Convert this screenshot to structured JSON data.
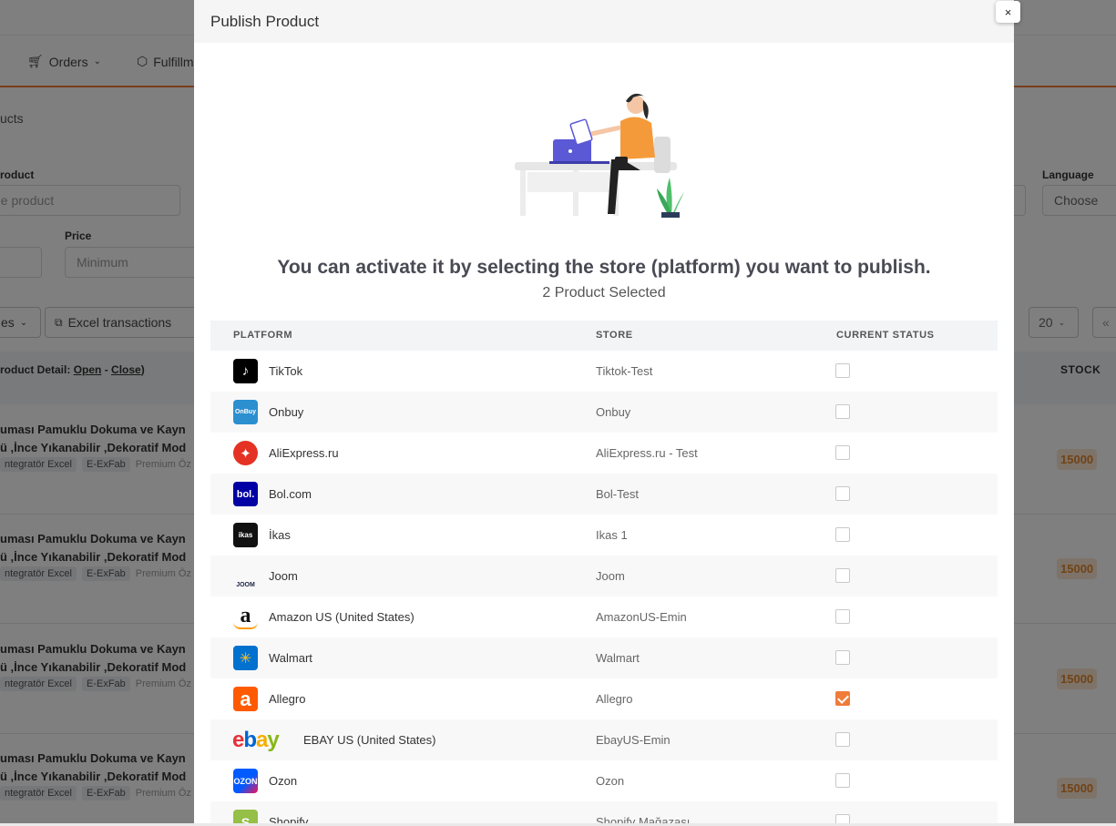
{
  "background": {
    "nav": {
      "orders": "Orders",
      "fulfillment": "Fulfillm"
    },
    "breadcrumb": "ucts",
    "filters": {
      "product_label": "roduct",
      "product_placeholder": "he product",
      "price_label": "Price",
      "price_min_placeholder": "Minimum",
      "language_label": "Language",
      "language_value": "Choose"
    },
    "toolbar": {
      "es_label": "es",
      "excel_label": "Excel transactions",
      "page_size": "20"
    },
    "table": {
      "product_detail": "roduct Detail:",
      "open": "Open",
      "close": "Close",
      "stock_header": "STOCK",
      "rows": [
        {
          "line1": "uması Pamuklu Dokuma ve Kayn",
          "line2": "ü ,İnce Yıkanabilir ,Dekoratif Mod",
          "tag1": "ntegratör Excel",
          "tag2": "E-ExFab",
          "tag3": "Premium Öz",
          "stock": "15000"
        },
        {
          "line1": "uması Pamuklu Dokuma ve Kayn",
          "line2": "ü ,İnce Yıkanabilir ,Dekoratif Mod",
          "tag1": "ntegratör Excel",
          "tag2": "E-ExFab",
          "tag3": "Premium Öz",
          "stock": "15000"
        },
        {
          "line1": "uması Pamuklu Dokuma ve Kayn",
          "line2": "ü ,İnce Yıkanabilir ,Dekoratif Mod",
          "tag1": "ntegratör Excel",
          "tag2": "E-ExFab",
          "tag3": "Premium Öz",
          "stock": "15000"
        },
        {
          "line1": "uması Pamuklu Dokuma ve Kayn",
          "line2": "ü ,İnce Yıkanabilir ,Dekoratif Mod",
          "tag1": "ntegratör Excel",
          "tag2": "E-ExFab",
          "tag3": "Premium Öz",
          "stock": "15000"
        }
      ]
    }
  },
  "modal": {
    "title": "Publish Product",
    "close_label": "×",
    "heading": "You can activate it by selecting the store (platform) you want to publish.",
    "subheading": "2 Product Selected",
    "columns": {
      "platform": "PLATFORM",
      "store": "STORE",
      "status": "CURRENT STATUS"
    },
    "rows": [
      {
        "platform": "TikTok",
        "store": "Tiktok-Test",
        "checked": false,
        "logo_text": "♪",
        "logo_color": "#000000",
        "logo_icon": "tiktok-logo-icon"
      },
      {
        "platform": "Onbuy",
        "store": "Onbuy",
        "checked": false,
        "logo_text": "OnBuy",
        "logo_color": "#2b8fd0",
        "logo_icon": "onbuy-logo-icon"
      },
      {
        "platform": "AliExpress.ru",
        "store": "AliExpress.ru - Test",
        "checked": false,
        "logo_text": "✦",
        "logo_color": "#e43225",
        "logo_icon": "aliexpress-logo-icon"
      },
      {
        "platform": "Bol.com",
        "store": "Bol-Test",
        "checked": false,
        "logo_text": "bol.",
        "logo_color": "#0000a4",
        "logo_icon": "bol-logo-icon"
      },
      {
        "platform": "İkas",
        "store": "Ikas 1",
        "checked": false,
        "logo_text": "ikas",
        "logo_color": "#111111",
        "logo_icon": "ikas-logo-icon"
      },
      {
        "platform": "Joom",
        "store": "Joom",
        "checked": false,
        "logo_text": "JOOM",
        "logo_color": "#ffffff",
        "logo_icon": "joom-logo-icon"
      },
      {
        "platform": "Amazon US (United States)",
        "store": "AmazonUS-Emin",
        "checked": false,
        "logo_text": "a",
        "logo_color": "#ffffff",
        "logo_icon": "amazon-logo-icon"
      },
      {
        "platform": "Walmart",
        "store": "Walmart",
        "checked": false,
        "logo_text": "✳",
        "logo_color": "#0071ce",
        "logo_icon": "walmart-logo-icon"
      },
      {
        "platform": "Allegro",
        "store": "Allegro",
        "checked": true,
        "logo_text": "a",
        "logo_color": "#ff5a00",
        "logo_icon": "allegro-logo-icon"
      },
      {
        "platform": "EBAY US (United States)",
        "store": "EbayUS-Emin",
        "checked": false,
        "logo_text": "ebay",
        "logo_color": "#ffffff",
        "logo_icon": "ebay-logo-icon"
      },
      {
        "platform": "Ozon",
        "store": "Ozon",
        "checked": false,
        "logo_text": "OZON",
        "logo_color": "#005bff",
        "logo_icon": "ozon-logo-icon"
      },
      {
        "platform": "Shopify",
        "store": "Shopify Mağazası",
        "checked": false,
        "logo_text": "S",
        "logo_color": "#95bf47",
        "logo_icon": "shopify-logo-icon"
      }
    ]
  }
}
